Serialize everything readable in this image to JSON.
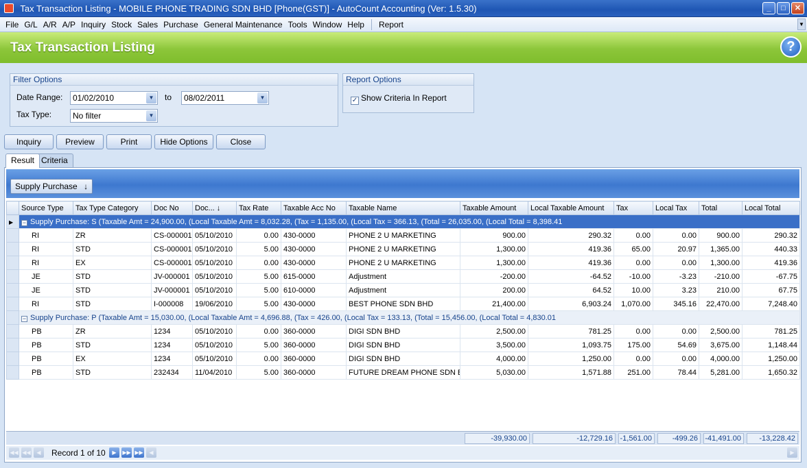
{
  "window": {
    "title": "Tax Transaction Listing  - MOBILE PHONE TRADING SDN BHD [Phone(GST)] - AutoCount Accounting (Ver: 1.5.30)"
  },
  "menu": [
    "File",
    "G/L",
    "A/R",
    "A/P",
    "Inquiry",
    "Stock",
    "Sales",
    "Purchase",
    "General Maintenance",
    "Tools",
    "Window",
    "Help",
    "Report"
  ],
  "header": {
    "title": "Tax Transaction Listing"
  },
  "filter": {
    "title": "Filter Options",
    "date_range_label": "Date Range:",
    "date_from": "01/02/2010",
    "to_label": "to",
    "date_to": "08/02/2011",
    "tax_type_label": "Tax Type:",
    "tax_type_value": "No filter"
  },
  "report_options": {
    "title": "Report Options",
    "show_criteria_label": "Show Criteria In Report",
    "show_criteria_checked": true
  },
  "buttons": {
    "inquiry": "Inquiry",
    "preview": "Preview",
    "print": "Print",
    "hide_options": "Hide Options",
    "close": "Close"
  },
  "tabs": {
    "result": "Result",
    "criteria": "Criteria"
  },
  "group_by_button": "Supply Purchase",
  "columns": [
    "Source Type",
    "Tax Type Category",
    "Doc No",
    "Doc...",
    "Tax Rate",
    "Taxable Acc No",
    "Taxable Name",
    "Taxable Amount",
    "Local Taxable Amount",
    "Tax",
    "Local Tax",
    "Total",
    "Local Total"
  ],
  "groups": [
    {
      "label": "Supply Purchase: S (Taxable Amt = 24,900.00, (Local Taxable Amt = 8,032.28, (Tax = 1,135.00, (Local Tax = 366.13, (Total = 26,035.00, (Local Total = 8,398.41",
      "rows": [
        [
          "RI",
          "ZR",
          "CS-000001",
          "05/10/2010",
          "0.00",
          "430-0000",
          "PHONE 2 U MARKETING",
          "900.00",
          "290.32",
          "0.00",
          "0.00",
          "900.00",
          "290.32"
        ],
        [
          "RI",
          "STD",
          "CS-000001",
          "05/10/2010",
          "5.00",
          "430-0000",
          "PHONE 2 U MARKETING",
          "1,300.00",
          "419.36",
          "65.00",
          "20.97",
          "1,365.00",
          "440.33"
        ],
        [
          "RI",
          "EX",
          "CS-000001",
          "05/10/2010",
          "0.00",
          "430-0000",
          "PHONE 2 U MARKETING",
          "1,300.00",
          "419.36",
          "0.00",
          "0.00",
          "1,300.00",
          "419.36"
        ],
        [
          "JE",
          "STD",
          "JV-000001",
          "05/10/2010",
          "5.00",
          "615-0000",
          "Adjustment",
          "-200.00",
          "-64.52",
          "-10.00",
          "-3.23",
          "-210.00",
          "-67.75"
        ],
        [
          "JE",
          "STD",
          "JV-000001",
          "05/10/2010",
          "5.00",
          "610-0000",
          "Adjustment",
          "200.00",
          "64.52",
          "10.00",
          "3.23",
          "210.00",
          "67.75"
        ],
        [
          "RI",
          "STD",
          "I-000008",
          "19/06/2010",
          "5.00",
          "430-0000",
          "BEST PHONE SDN BHD",
          "21,400.00",
          "6,903.24",
          "1,070.00",
          "345.16",
          "22,470.00",
          "7,248.40"
        ]
      ]
    },
    {
      "label": "Supply Purchase: P (Taxable Amt = 15,030.00, (Local Taxable Amt = 4,696.88, (Tax = 426.00, (Local Tax = 133.13, (Total = 15,456.00, (Local Total = 4,830.01",
      "rows": [
        [
          "PB",
          "ZR",
          "1234",
          "05/10/2010",
          "0.00",
          "360-0000",
          "DIGI SDN BHD",
          "2,500.00",
          "781.25",
          "0.00",
          "0.00",
          "2,500.00",
          "781.25"
        ],
        [
          "PB",
          "STD",
          "1234",
          "05/10/2010",
          "5.00",
          "360-0000",
          "DIGI SDN BHD",
          "3,500.00",
          "1,093.75",
          "175.00",
          "54.69",
          "3,675.00",
          "1,148.44"
        ],
        [
          "PB",
          "EX",
          "1234",
          "05/10/2010",
          "0.00",
          "360-0000",
          "DIGI SDN BHD",
          "4,000.00",
          "1,250.00",
          "0.00",
          "0.00",
          "4,000.00",
          "1,250.00"
        ],
        [
          "PB",
          "STD",
          "232434",
          "11/04/2010",
          "5.00",
          "360-0000",
          "FUTURE DREAM PHONE SDN BHD",
          "5,030.00",
          "1,571.88",
          "251.00",
          "78.44",
          "5,281.00",
          "1,650.32"
        ]
      ]
    }
  ],
  "totals": {
    "taxable_amount": "-39,930.00",
    "local_taxable_amount": "-12,729.16",
    "tax": "-1,561.00",
    "local_tax": "-499.26",
    "total": "-41,491.00",
    "local_total": "-13,228.42"
  },
  "navigator": {
    "record_text": "Record 1 of 10"
  },
  "colors": {
    "header_green": "#8cc63a",
    "title_blue": "#1f56b4",
    "selected_row": "#3a6fc7"
  }
}
